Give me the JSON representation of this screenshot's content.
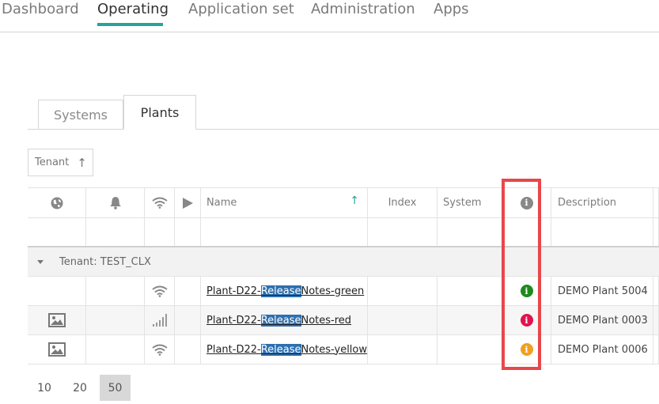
{
  "nav": {
    "items": [
      "Dashboard",
      "Operating",
      "Application set",
      "Administration",
      "Apps"
    ],
    "active": "Operating"
  },
  "tabs": {
    "systems": "Systems",
    "plants": "Plants"
  },
  "tenant_sort": {
    "label": "Tenant",
    "direction_icon": "arrow-up-icon"
  },
  "grid": {
    "headers": {
      "location_icon": "globe-icon",
      "alarm_icon": "bell-icon",
      "connection_icon": "wifi-icon",
      "status_icon": "play-icon",
      "name": "Name",
      "index": "Index",
      "system": "System",
      "info_icon": "info-icon",
      "description": "Description"
    },
    "group": {
      "label": "Tenant: TEST_CLX"
    },
    "rows": [
      {
        "image": false,
        "signal": "wifi",
        "name_pre": "Plant-D22-",
        "name_hl": "Release",
        "name_post": "Notes-green",
        "info_color": "#1e8a1e",
        "description": "DEMO Plant 5004"
      },
      {
        "image": true,
        "signal": "bars",
        "name_pre": "Plant-D22-",
        "name_hl": "Release",
        "name_post": "Notes-red",
        "info_color": "#e0144c",
        "description": "DEMO Plant 0003"
      },
      {
        "image": true,
        "signal": "wifi",
        "name_pre": "Plant-D22-",
        "name_hl": "Release",
        "name_post": "Notes-yellow",
        "info_color": "#f0a020",
        "description": "DEMO Plant 0006"
      }
    ]
  },
  "pager": {
    "sizes": [
      "10",
      "20",
      "50"
    ],
    "active": "50"
  },
  "colors": {
    "accent": "#27a39a",
    "highlight_box": "#e8474b",
    "selection": "#2d6fb0"
  }
}
